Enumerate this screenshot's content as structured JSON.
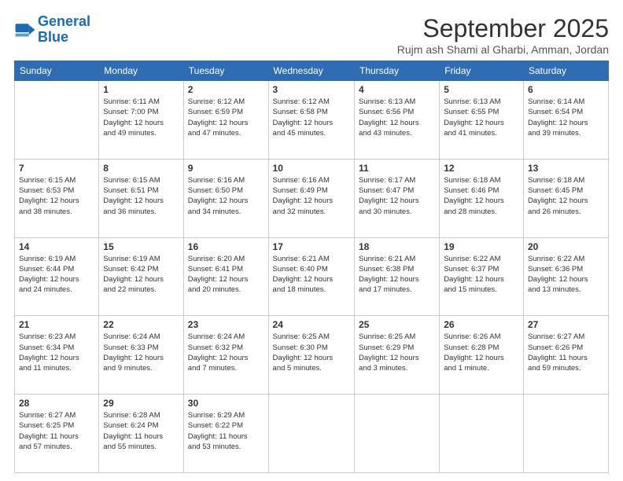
{
  "logo": {
    "line1": "General",
    "line2": "Blue"
  },
  "title": "September 2025",
  "subtitle": "Rujm ash Shami al Gharbi, Amman, Jordan",
  "days_of_week": [
    "Sunday",
    "Monday",
    "Tuesday",
    "Wednesday",
    "Thursday",
    "Friday",
    "Saturday"
  ],
  "weeks": [
    [
      {
        "day": "",
        "content": ""
      },
      {
        "day": "1",
        "content": "Sunrise: 6:11 AM\nSunset: 7:00 PM\nDaylight: 12 hours\nand 49 minutes."
      },
      {
        "day": "2",
        "content": "Sunrise: 6:12 AM\nSunset: 6:59 PM\nDaylight: 12 hours\nand 47 minutes."
      },
      {
        "day": "3",
        "content": "Sunrise: 6:12 AM\nSunset: 6:58 PM\nDaylight: 12 hours\nand 45 minutes."
      },
      {
        "day": "4",
        "content": "Sunrise: 6:13 AM\nSunset: 6:56 PM\nDaylight: 12 hours\nand 43 minutes."
      },
      {
        "day": "5",
        "content": "Sunrise: 6:13 AM\nSunset: 6:55 PM\nDaylight: 12 hours\nand 41 minutes."
      },
      {
        "day": "6",
        "content": "Sunrise: 6:14 AM\nSunset: 6:54 PM\nDaylight: 12 hours\nand 39 minutes."
      }
    ],
    [
      {
        "day": "7",
        "content": "Sunrise: 6:15 AM\nSunset: 6:53 PM\nDaylight: 12 hours\nand 38 minutes."
      },
      {
        "day": "8",
        "content": "Sunrise: 6:15 AM\nSunset: 6:51 PM\nDaylight: 12 hours\nand 36 minutes."
      },
      {
        "day": "9",
        "content": "Sunrise: 6:16 AM\nSunset: 6:50 PM\nDaylight: 12 hours\nand 34 minutes."
      },
      {
        "day": "10",
        "content": "Sunrise: 6:16 AM\nSunset: 6:49 PM\nDaylight: 12 hours\nand 32 minutes."
      },
      {
        "day": "11",
        "content": "Sunrise: 6:17 AM\nSunset: 6:47 PM\nDaylight: 12 hours\nand 30 minutes."
      },
      {
        "day": "12",
        "content": "Sunrise: 6:18 AM\nSunset: 6:46 PM\nDaylight: 12 hours\nand 28 minutes."
      },
      {
        "day": "13",
        "content": "Sunrise: 6:18 AM\nSunset: 6:45 PM\nDaylight: 12 hours\nand 26 minutes."
      }
    ],
    [
      {
        "day": "14",
        "content": "Sunrise: 6:19 AM\nSunset: 6:44 PM\nDaylight: 12 hours\nand 24 minutes."
      },
      {
        "day": "15",
        "content": "Sunrise: 6:19 AM\nSunset: 6:42 PM\nDaylight: 12 hours\nand 22 minutes."
      },
      {
        "day": "16",
        "content": "Sunrise: 6:20 AM\nSunset: 6:41 PM\nDaylight: 12 hours\nand 20 minutes."
      },
      {
        "day": "17",
        "content": "Sunrise: 6:21 AM\nSunset: 6:40 PM\nDaylight: 12 hours\nand 18 minutes."
      },
      {
        "day": "18",
        "content": "Sunrise: 6:21 AM\nSunset: 6:38 PM\nDaylight: 12 hours\nand 17 minutes."
      },
      {
        "day": "19",
        "content": "Sunrise: 6:22 AM\nSunset: 6:37 PM\nDaylight: 12 hours\nand 15 minutes."
      },
      {
        "day": "20",
        "content": "Sunrise: 6:22 AM\nSunset: 6:36 PM\nDaylight: 12 hours\nand 13 minutes."
      }
    ],
    [
      {
        "day": "21",
        "content": "Sunrise: 6:23 AM\nSunset: 6:34 PM\nDaylight: 12 hours\nand 11 minutes."
      },
      {
        "day": "22",
        "content": "Sunrise: 6:24 AM\nSunset: 6:33 PM\nDaylight: 12 hours\nand 9 minutes."
      },
      {
        "day": "23",
        "content": "Sunrise: 6:24 AM\nSunset: 6:32 PM\nDaylight: 12 hours\nand 7 minutes."
      },
      {
        "day": "24",
        "content": "Sunrise: 6:25 AM\nSunset: 6:30 PM\nDaylight: 12 hours\nand 5 minutes."
      },
      {
        "day": "25",
        "content": "Sunrise: 6:25 AM\nSunset: 6:29 PM\nDaylight: 12 hours\nand 3 minutes."
      },
      {
        "day": "26",
        "content": "Sunrise: 6:26 AM\nSunset: 6:28 PM\nDaylight: 12 hours\nand 1 minute."
      },
      {
        "day": "27",
        "content": "Sunrise: 6:27 AM\nSunset: 6:26 PM\nDaylight: 11 hours\nand 59 minutes."
      }
    ],
    [
      {
        "day": "28",
        "content": "Sunrise: 6:27 AM\nSunset: 6:25 PM\nDaylight: 11 hours\nand 57 minutes."
      },
      {
        "day": "29",
        "content": "Sunrise: 6:28 AM\nSunset: 6:24 PM\nDaylight: 11 hours\nand 55 minutes."
      },
      {
        "day": "30",
        "content": "Sunrise: 6:29 AM\nSunset: 6:22 PM\nDaylight: 11 hours\nand 53 minutes."
      },
      {
        "day": "",
        "content": ""
      },
      {
        "day": "",
        "content": ""
      },
      {
        "day": "",
        "content": ""
      },
      {
        "day": "",
        "content": ""
      }
    ]
  ]
}
